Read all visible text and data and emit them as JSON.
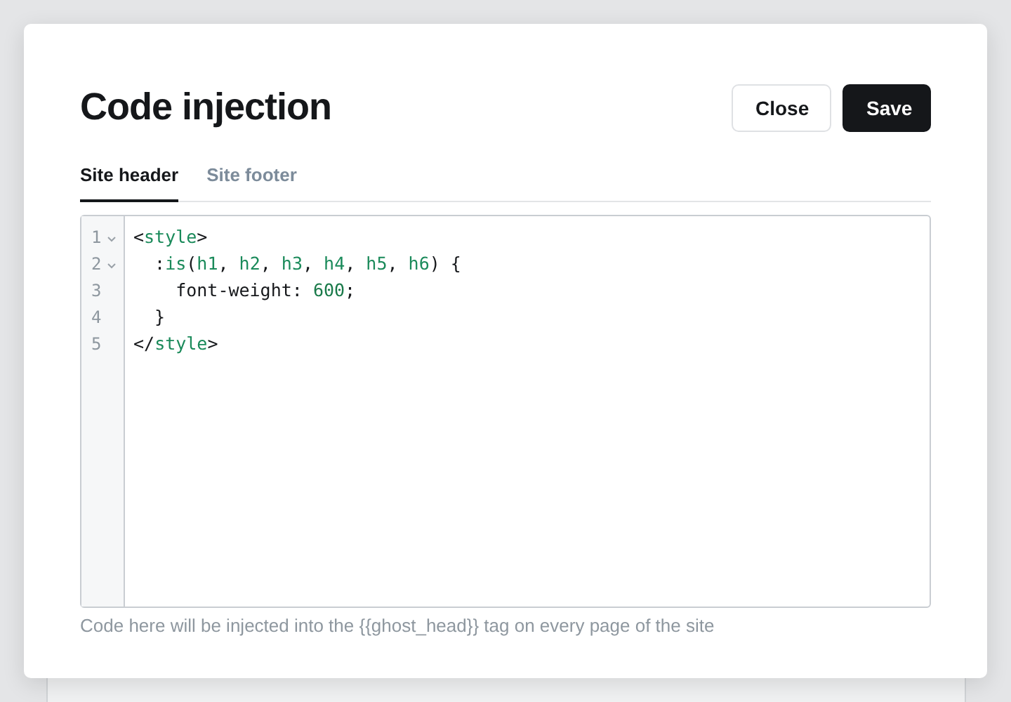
{
  "dialog": {
    "title": "Code injection",
    "buttons": [
      {
        "label": "Close",
        "kind": "secondary"
      },
      {
        "label": "Save",
        "kind": "primary"
      }
    ]
  },
  "tabs": [
    {
      "label": "Site header",
      "selected": true
    },
    {
      "label": "Site footer",
      "selected": false
    }
  ],
  "editor": {
    "lines": [
      {
        "number": "1",
        "foldable": true,
        "tokens": [
          {
            "text": "<",
            "kind": "plain"
          },
          {
            "text": "style",
            "kind": "tag"
          },
          {
            "text": ">",
            "kind": "plain"
          }
        ]
      },
      {
        "number": "2",
        "foldable": true,
        "tokens": [
          {
            "text": "  :",
            "kind": "plain"
          },
          {
            "text": "is",
            "kind": "tag"
          },
          {
            "text": "(",
            "kind": "plain"
          },
          {
            "text": "h1",
            "kind": "tag"
          },
          {
            "text": ", ",
            "kind": "plain"
          },
          {
            "text": "h2",
            "kind": "tag"
          },
          {
            "text": ", ",
            "kind": "plain"
          },
          {
            "text": "h3",
            "kind": "tag"
          },
          {
            "text": ", ",
            "kind": "plain"
          },
          {
            "text": "h4",
            "kind": "tag"
          },
          {
            "text": ", ",
            "kind": "plain"
          },
          {
            "text": "h5",
            "kind": "tag"
          },
          {
            "text": ", ",
            "kind": "plain"
          },
          {
            "text": "h6",
            "kind": "tag"
          },
          {
            "text": ") {",
            "kind": "plain"
          }
        ]
      },
      {
        "number": "3",
        "foldable": false,
        "tokens": [
          {
            "text": "    font-weight: ",
            "kind": "plain"
          },
          {
            "text": "600",
            "kind": "number"
          },
          {
            "text": ";",
            "kind": "plain"
          }
        ]
      },
      {
        "number": "4",
        "foldable": false,
        "tokens": [
          {
            "text": "  }",
            "kind": "plain"
          }
        ]
      },
      {
        "number": "5",
        "foldable": false,
        "tokens": [
          {
            "text": "</",
            "kind": "plain"
          },
          {
            "text": "style",
            "kind": "tag"
          },
          {
            "text": ">",
            "kind": "plain"
          }
        ]
      }
    ]
  },
  "hint": "Code here will be injected into the {{ghost_head}} tag on every page of the site"
}
